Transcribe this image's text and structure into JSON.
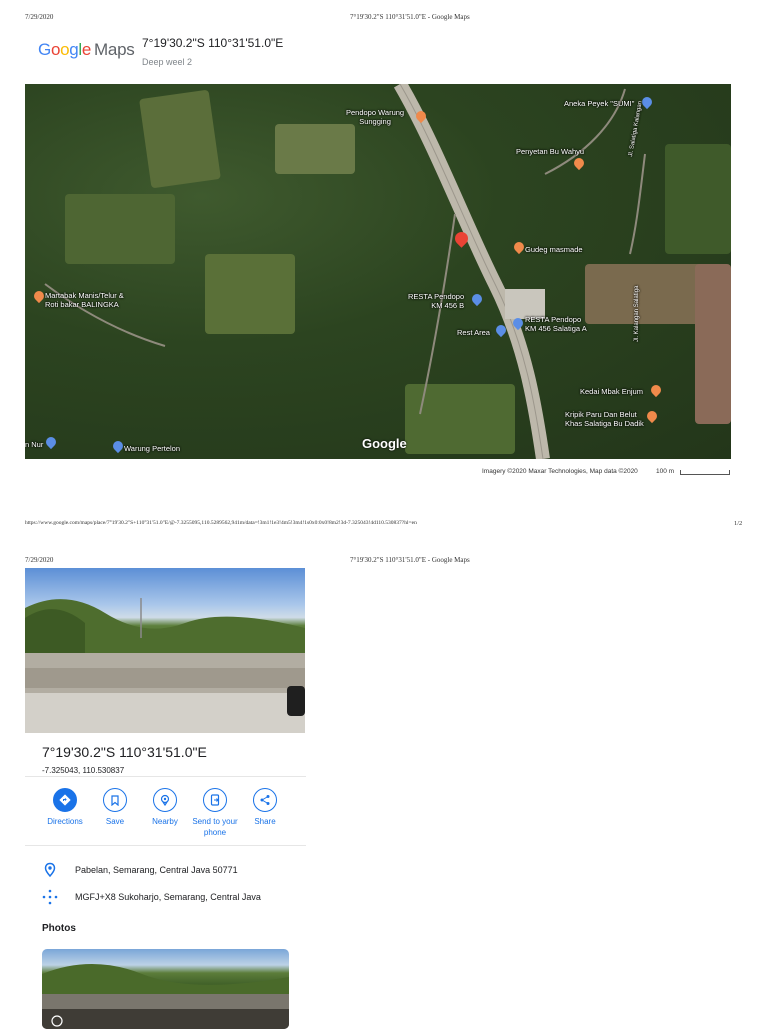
{
  "print_header": {
    "date": "7/29/2020",
    "title": "7°19'30.2\"S 110°31'51.0\"E - Google Maps"
  },
  "logo": {
    "letters": [
      "G",
      "o",
      "o",
      "g",
      "l",
      "e"
    ],
    "maps": "Maps"
  },
  "header": {
    "coords": "7°19'30.2\"S 110°31'51.0\"E",
    "subtitle": "Deep weel 2"
  },
  "map": {
    "places": [
      {
        "label": "Pendopo Warung\nSungging",
        "pin": "orange"
      },
      {
        "label": "Aneka Peyek \"SUMI\"",
        "pin": "blue"
      },
      {
        "label": "Penyetan Bu Wahyu",
        "pin": "orange"
      },
      {
        "label": "Gudeg masmade",
        "pin": "orange"
      },
      {
        "label": "Martabak Manis/Telur &\nRoti bakar BALINGKA",
        "pin": "orange"
      },
      {
        "label": "RESTA Pendopo\nKM 456 B",
        "pin": "blue"
      },
      {
        "label": "RESTA Pendopo\nKM 456 Salatiga A",
        "pin": "blue"
      },
      {
        "label": "Rest Area",
        "pin": "blue"
      },
      {
        "label": "Kedai Mbak Enjum",
        "pin": "orange"
      },
      {
        "label": "Kripik Paru Dan Belut\nKhas Salatiga Bu Dadik",
        "pin": "orange"
      },
      {
        "label": "Warung Pertelon",
        "pin": "blue"
      },
      {
        "label": "n Nur",
        "pin": "blue"
      }
    ],
    "road_labels": [
      "Jl. Salatiga Kalangan",
      "Jl. Kalangan Salatiga"
    ],
    "watermark": "Google",
    "attribution": "Imagery ©2020 Maxar Technologies, Map data ©2020",
    "scale": "100 m"
  },
  "footer": {
    "url": "https://www.google.com/maps/place/7°19'30.2\"S+110°31'51.0\"E/@-7.3255095,110.5289562,941m/data=!3m1!1e3!4m5!3m4!1s0x0:0x0!8m2!3d-7.325043!4d110.530837?hl=en",
    "page": "1/2"
  },
  "place": {
    "title": "7°19'30.2\"S 110°31'51.0\"E",
    "coords": "-7.325043, 110.530837"
  },
  "actions": [
    {
      "label": "Directions",
      "icon": "directions-icon"
    },
    {
      "label": "Save",
      "icon": "bookmark-icon"
    },
    {
      "label": "Nearby",
      "icon": "nearby-icon"
    },
    {
      "label": "Send to your phone",
      "icon": "send-to-phone-icon"
    },
    {
      "label": "Share",
      "icon": "share-icon"
    }
  ],
  "info": {
    "address": "Pabelan, Semarang, Central Java 50771",
    "plus_code": "MGFJ+X8 Sukoharjo, Semarang, Central Java"
  },
  "photos_heading": "Photos",
  "colors": {
    "accent": "#1a73e8",
    "pin_red": "#ea4335",
    "pin_orange": "#f08a4b",
    "pin_blue": "#5b8ee6"
  }
}
